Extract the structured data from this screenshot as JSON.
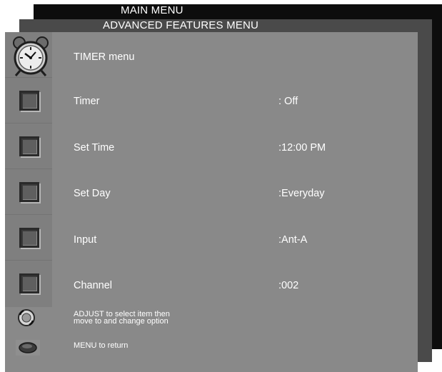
{
  "layers": {
    "main_menu_title": "MAIN MENU",
    "advanced_menu_title": "ADVANCED FEATURES MENU"
  },
  "panel": {
    "title": "TIMER menu",
    "title_icon": "alarm-clock-icon",
    "rows": [
      {
        "label": "Timer",
        "value": ": Off",
        "icon": "square-button-icon"
      },
      {
        "label": "Set Time",
        "value": ":12:00 PM",
        "icon": "square-button-icon"
      },
      {
        "label": "Set Day",
        "value": ":Everyday",
        "icon": "square-button-icon"
      },
      {
        "label": "Input",
        "value": ":Ant-A",
        "icon": "square-button-icon"
      },
      {
        "label": "Channel",
        "value": ":002",
        "icon": "square-button-icon"
      }
    ],
    "hints": {
      "adjust_line1": "ADJUST to select item then",
      "adjust_line2": "move to and change option",
      "adjust_icon": "adjust-knob-icon",
      "menu_return": "MENU to return",
      "menu_icon": "menu-button-icon"
    }
  },
  "colors": {
    "panel_bg": "#898989",
    "icon_column_bg": "#7f7f7f",
    "main_layer_bg": "#0d0d0d",
    "advanced_layer_bg": "#4a4a4a",
    "text": "#ffffff"
  }
}
